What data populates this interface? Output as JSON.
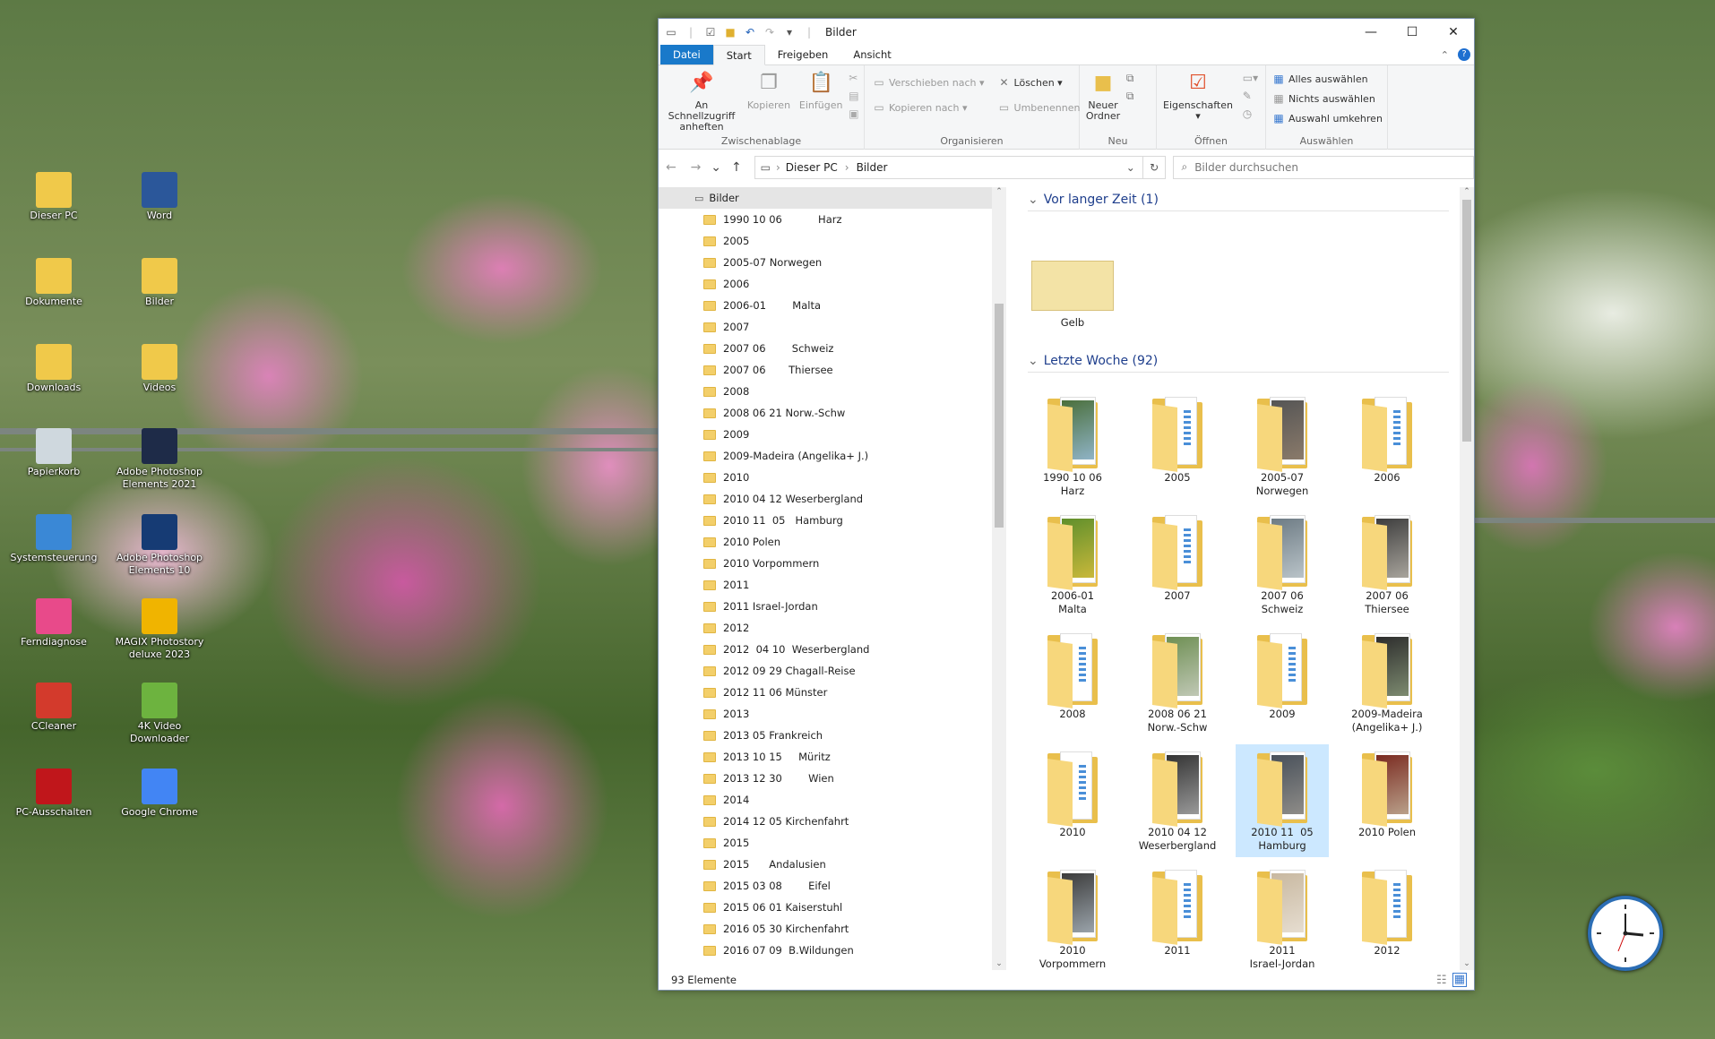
{
  "desktop_icons": [
    {
      "label": "Dieser PC",
      "icon": "pc-icon",
      "color": "#f0c94a"
    },
    {
      "label": "Word",
      "icon": "word-icon",
      "color": "#2b579a"
    },
    {
      "label": "Dokumente",
      "icon": "documents-folder-icon",
      "color": "#f0c94a"
    },
    {
      "label": "Bilder",
      "icon": "pictures-folder-icon",
      "color": "#f0c94a"
    },
    {
      "label": "Downloads",
      "icon": "downloads-folder-icon",
      "color": "#f0c94a"
    },
    {
      "label": "Videos",
      "icon": "videos-folder-icon",
      "color": "#f0c94a"
    },
    {
      "label": "Papierkorb",
      "icon": "recycle-bin-icon",
      "color": "#cfd8de"
    },
    {
      "label": "Adobe Photoshop Elements 2021",
      "icon": "photoshop-elements-icon",
      "color": "#1e2b48"
    },
    {
      "label": "Systemsteuerung",
      "icon": "control-panel-icon",
      "color": "#3a88d6"
    },
    {
      "label": "Adobe Photoshop Elements 10",
      "icon": "photoshop-elements-icon",
      "color": "#163b74"
    },
    {
      "label": "Ferndiagnose",
      "icon": "remote-diagnosis-icon",
      "color": "#e84a8a"
    },
    {
      "label": "MAGIX Photostory deluxe 2023",
      "icon": "magix-icon",
      "color": "#f0b400"
    },
    {
      "label": "CCleaner",
      "icon": "ccleaner-icon",
      "color": "#d33a2c"
    },
    {
      "label": "4K Video Downloader",
      "icon": "video-downloader-icon",
      "color": "#6db33f"
    },
    {
      "label": "PC-Ausschalten",
      "icon": "power-icon",
      "color": "#c0161b"
    },
    {
      "label": "Google Chrome",
      "icon": "chrome-icon",
      "color": "#4285f4"
    }
  ],
  "window": {
    "title": "Bilder"
  },
  "tabs": [
    "Datei",
    "Start",
    "Freigeben",
    "Ansicht"
  ],
  "ribbon": {
    "clipboard": {
      "pin": "An Schnellzugriff anheften",
      "copy": "Kopieren",
      "paste": "Einfügen",
      "label": "Zwischenablage"
    },
    "organize": {
      "move": "Verschieben nach",
      "copyto": "Kopieren nach",
      "delete": "Löschen",
      "rename": "Umbenennen",
      "label": "Organisieren"
    },
    "new": {
      "folder": "Neuer Ordner",
      "label": "Neu"
    },
    "open": {
      "props": "Eigenschaften",
      "label": "Öffnen"
    },
    "select": {
      "all": "Alles auswählen",
      "none": "Nichts auswählen",
      "invert": "Auswahl umkehren",
      "label": "Auswählen"
    }
  },
  "address": {
    "crumbs": [
      "Dieser PC",
      "Bilder"
    ],
    "search_placeholder": "Bilder durchsuchen"
  },
  "nav": {
    "root": "Bilder",
    "items": [
      "1990 10 06           Harz",
      "2005",
      "2005-07 Norwegen",
      "2006",
      "2006-01        Malta",
      "2007",
      "2007 06        Schweiz",
      "2007 06       Thiersee",
      "2008",
      "2008 06 21 Norw.-Schw",
      "2009",
      "2009-Madeira (Angelika+ J.)",
      "2010",
      "2010 04 12 Weserbergland",
      "2010 11  05   Hamburg",
      "2010 Polen",
      "2010 Vorpommern",
      "2011",
      "2011 Israel-Jordan",
      "2012",
      "2012  04 10  Weserbergland",
      "2012 09 29 Chagall-Reise",
      "2012 11 06 Münster",
      "2013",
      "2013 05 Frankreich",
      "2013 10 15     Müritz",
      "2013 12 30        Wien",
      "2014",
      "2014 12 05 Kirchenfahrt",
      "2015",
      "2015      Andalusien",
      "2015 03 08        Eifel",
      "2015 06 01 Kaiserstuhl",
      "2016 05 30 Kirchenfahrt",
      "2016 07 09  B.Wildungen"
    ]
  },
  "groups": [
    {
      "title": "Vor langer Zeit (1)",
      "items": [
        {
          "label": "Gelb",
          "type": "plain"
        }
      ]
    },
    {
      "title": "Letzte Woche (92)",
      "items": [
        {
          "label": "1990 10 06\nHarz",
          "type": "photo",
          "colors": [
            "#4a6f3b",
            "#8fb3c6"
          ]
        },
        {
          "label": "2005",
          "type": "folder"
        },
        {
          "label": "2005-07\nNorwegen",
          "type": "photo",
          "colors": [
            "#555",
            "#8a7a6a"
          ]
        },
        {
          "label": "2006",
          "type": "folder"
        },
        {
          "label": "2006-01\nMalta",
          "type": "photo",
          "colors": [
            "#5f8f2c",
            "#c9b83a"
          ]
        },
        {
          "label": "2007",
          "type": "folder"
        },
        {
          "label": "2007 06\nSchweiz",
          "type": "photo",
          "colors": [
            "#6d7b84",
            "#b9c3c8"
          ]
        },
        {
          "label": "2007 06\nThiersee",
          "type": "photo",
          "colors": [
            "#3d3d3d",
            "#a8a49c"
          ]
        },
        {
          "label": "2008",
          "type": "folder"
        },
        {
          "label": "2008 06 21\nNorw.-Schw",
          "type": "photo",
          "colors": [
            "#6e8f53",
            "#c0c8b5"
          ]
        },
        {
          "label": "2009",
          "type": "folder"
        },
        {
          "label": "2009-Madeira\n(Angelika+ J.)",
          "type": "photo",
          "colors": [
            "#2c2c2c",
            "#7d8b70"
          ]
        },
        {
          "label": "2010",
          "type": "folder"
        },
        {
          "label": "2010 04 12\nWeserbergland",
          "type": "photo",
          "colors": [
            "#333",
            "#999"
          ]
        },
        {
          "label": "2010 11  05\nHamburg",
          "type": "photo",
          "colors": [
            "#48505a",
            "#8e8c88"
          ],
          "selected": true
        },
        {
          "label": "2010 Polen",
          "type": "photo",
          "colors": [
            "#7a2a20",
            "#b9a08a"
          ]
        },
        {
          "label": "2010\nVorpommern",
          "type": "photo",
          "colors": [
            "#3b3b3b",
            "#9aa3aa"
          ]
        },
        {
          "label": "2011",
          "type": "folder"
        },
        {
          "label": "2011\nIsrael-Jordan",
          "type": "photo",
          "colors": [
            "#c8b8a0",
            "#e6ddd0"
          ]
        },
        {
          "label": "2012",
          "type": "folder"
        }
      ]
    }
  ],
  "status": "93 Elemente"
}
